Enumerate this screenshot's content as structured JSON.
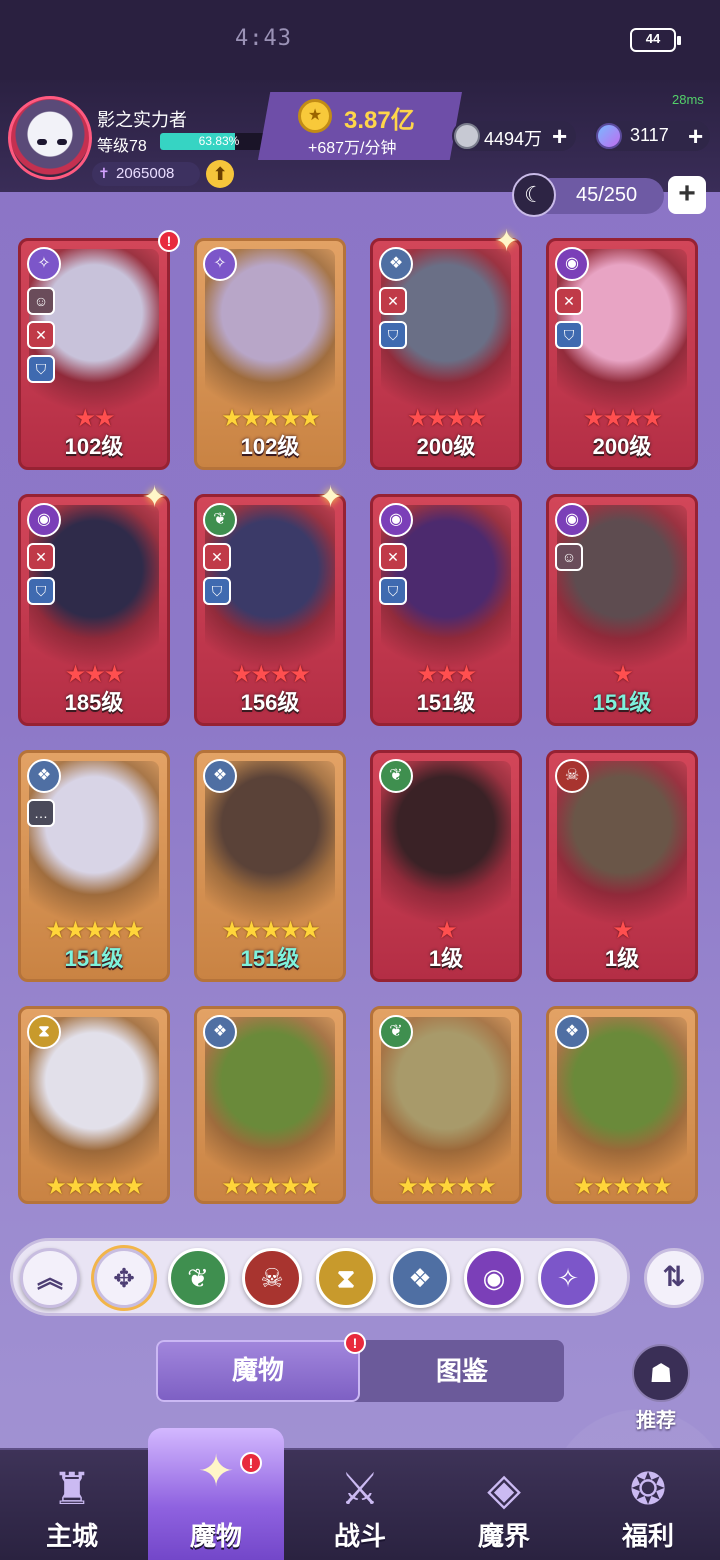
{
  "status": {
    "time": "4:43",
    "battery": "44"
  },
  "player": {
    "name": "影之实力者",
    "level_label": "等级78",
    "exp_percent": "63.83%",
    "exp_fraction": 0.6383,
    "power": "2065008"
  },
  "gold": {
    "amount": "3.87亿",
    "rate": "+687万/分钟"
  },
  "ping": "28ms",
  "resources": {
    "silver": "4494万",
    "gems": "3117"
  },
  "capacity": "45/250",
  "cards": [
    {
      "name": "white-jester",
      "style": "red",
      "level": "102级",
      "level_color": "white",
      "stars": 2,
      "star_color": "red",
      "faction": "swirl-icon",
      "faction_color": "#7c56c9",
      "notify": true,
      "sparkle": false,
      "tags": [
        "portrait",
        "sword",
        "shield"
      ],
      "art_color": "#c8c2da"
    },
    {
      "name": "silver-mask-girl",
      "style": "gold",
      "level": "102级",
      "level_color": "white",
      "stars": 5,
      "star_color": "gold",
      "faction": "swirl-icon",
      "faction_color": "#7c56c9",
      "notify": false,
      "sparkle": false,
      "tags": [],
      "art_color": "#b8a6c8"
    },
    {
      "name": "armored-knight",
      "style": "red",
      "level": "200级",
      "level_color": "white",
      "stars": 4,
      "star_color": "red",
      "faction": "dragon-icon",
      "faction_color": "#4f6fa3",
      "notify": false,
      "sparkle": true,
      "tags": [
        "sword",
        "shield"
      ],
      "art_color": "#6a6f86"
    },
    {
      "name": "pink-demon-girl",
      "style": "red",
      "level": "200级",
      "level_color": "white",
      "stars": 4,
      "star_color": "red",
      "faction": "eye-icon",
      "faction_color": "#7b3fb8",
      "notify": false,
      "sparkle": false,
      "tags": [
        "sword",
        "shield"
      ],
      "art_color": "#e8a4c4"
    },
    {
      "name": "blonde-vampire",
      "style": "red",
      "level": "185级",
      "level_color": "white",
      "stars": 3,
      "star_color": "red",
      "faction": "eye-icon",
      "faction_color": "#7b3fb8",
      "notify": false,
      "sparkle": true,
      "tags": [
        "sword",
        "shield"
      ],
      "art_color": "#2f2b4a"
    },
    {
      "name": "blue-bonnet-lady",
      "style": "red",
      "level": "156级",
      "level_color": "white",
      "stars": 4,
      "star_color": "red",
      "faction": "leaf-icon",
      "faction_color": "#3f8f4f",
      "notify": false,
      "sparkle": true,
      "tags": [
        "sword",
        "shield"
      ],
      "art_color": "#3b3a68"
    },
    {
      "name": "purple-witch",
      "style": "red",
      "level": "151级",
      "level_color": "white",
      "stars": 3,
      "star_color": "red",
      "faction": "eye-icon",
      "faction_color": "#7b3fb8",
      "notify": false,
      "sparkle": false,
      "tags": [
        "sword",
        "shield"
      ],
      "art_color": "#4c2a6e"
    },
    {
      "name": "grey-hair-lady",
      "style": "red",
      "level": "151级",
      "level_color": "teal",
      "stars": 1,
      "star_color": "red",
      "faction": "eye-icon",
      "faction_color": "#7b3fb8",
      "notify": false,
      "sparkle": false,
      "tags": [
        "portrait"
      ],
      "art_color": "#5e4c50"
    },
    {
      "name": "white-werewolf",
      "style": "gold",
      "level": "151级",
      "level_color": "teal",
      "stars": 5,
      "star_color": "gold",
      "faction": "dragon-icon",
      "faction_color": "#4f6fa3",
      "notify": false,
      "sparkle": false,
      "tags": [
        "chat"
      ],
      "art_color": "#d8d4e6"
    },
    {
      "name": "horned-demon-girl",
      "style": "gold",
      "level": "151级",
      "level_color": "teal",
      "stars": 5,
      "star_color": "gold",
      "faction": "dragon-icon",
      "faction_color": "#4f6fa3",
      "notify": false,
      "sparkle": false,
      "tags": [],
      "art_color": "#5a4238"
    },
    {
      "name": "chain-rock-beast",
      "style": "red",
      "level": "1级",
      "level_color": "white",
      "stars": 1,
      "star_color": "red",
      "faction": "leaf-icon",
      "faction_color": "#3f8f4f",
      "notify": false,
      "sparkle": false,
      "tags": [],
      "art_color": "#3a2226"
    },
    {
      "name": "eagle-warrior",
      "style": "red",
      "level": "1级",
      "level_color": "white",
      "stars": 1,
      "star_color": "red",
      "faction": "skull-icon",
      "faction_color": "#a8342f",
      "notify": false,
      "sparkle": false,
      "tags": [],
      "art_color": "#6a5648"
    },
    {
      "name": "white-ghost",
      "style": "gold",
      "level": "",
      "level_color": "white",
      "stars": 5,
      "star_color": "gold",
      "faction": "hourglass-icon",
      "faction_color": "#c89a2c",
      "notify": false,
      "sparkle": false,
      "tags": [],
      "art_color": "#e2e0ea"
    },
    {
      "name": "red-lizard",
      "style": "gold",
      "level": "",
      "level_color": "white",
      "stars": 5,
      "star_color": "gold",
      "faction": "dragon-icon",
      "faction_color": "#4f6fa3",
      "notify": false,
      "sparkle": false,
      "tags": [],
      "art_color": "#6a8a3a"
    },
    {
      "name": "green-eye-bear",
      "style": "gold",
      "level": "",
      "level_color": "white",
      "stars": 5,
      "star_color": "gold",
      "faction": "leaf-icon",
      "faction_color": "#3f8f4f",
      "notify": false,
      "sparkle": false,
      "tags": [],
      "art_color": "#a89a6a"
    },
    {
      "name": "red-lizard-2",
      "style": "gold",
      "level": "",
      "level_color": "white",
      "stars": 5,
      "star_color": "gold",
      "faction": "dragon-icon",
      "faction_color": "#4f6fa3",
      "notify": false,
      "sparkle": false,
      "tags": [],
      "art_color": "#6a8a3a"
    }
  ],
  "filters": [
    {
      "name": "collapse-filter-button",
      "icon": "double-chevron-up-icon",
      "glyph": "︽",
      "color": "#f3f0fa",
      "text_color": "#4d3e74"
    },
    {
      "name": "filter-all-button",
      "icon": "diamond-grid-icon",
      "glyph": "✥",
      "color": "#f3f0fa",
      "text_color": "#4d3e74"
    },
    {
      "name": "filter-nature-button",
      "icon": "leaf-icon",
      "glyph": "❦",
      "color": "#3f8f4f",
      "text_color": "#ffffff"
    },
    {
      "name": "filter-skull-button",
      "icon": "skull-icon",
      "glyph": "☠",
      "color": "#a8342f",
      "text_color": "#ffffff"
    },
    {
      "name": "filter-hourglass-button",
      "icon": "hourglass-icon",
      "glyph": "⧗",
      "color": "#c89a2c",
      "text_color": "#ffffff"
    },
    {
      "name": "filter-dragon-button",
      "icon": "dragon-icon",
      "glyph": "❖",
      "color": "#4f6fa3",
      "text_color": "#ffffff"
    },
    {
      "name": "filter-eye-button",
      "icon": "eye-icon",
      "glyph": "◉",
      "color": "#7b3fb8",
      "text_color": "#ffffff"
    },
    {
      "name": "filter-swirl-button",
      "icon": "swirl-icon",
      "glyph": "✧",
      "color": "#7c56c9",
      "text_color": "#ffffff"
    }
  ],
  "tabs": {
    "monster": "魔物",
    "codex": "图鉴"
  },
  "recommend": "推荐",
  "nav": [
    {
      "name": "nav-main-city",
      "label": "主城",
      "icon": "castle-icon",
      "glyph": "♜"
    },
    {
      "name": "nav-monster",
      "label": "魔物",
      "icon": "flame-star-icon",
      "glyph": "✦"
    },
    {
      "name": "nav-battle",
      "label": "战斗",
      "icon": "shield-sword-icon",
      "glyph": "⚔"
    },
    {
      "name": "nav-demon-realm",
      "label": "魔界",
      "icon": "portal-icon",
      "glyph": "◈"
    },
    {
      "name": "nav-welfare",
      "label": "福利",
      "icon": "chest-icon",
      "glyph": "❂"
    }
  ]
}
